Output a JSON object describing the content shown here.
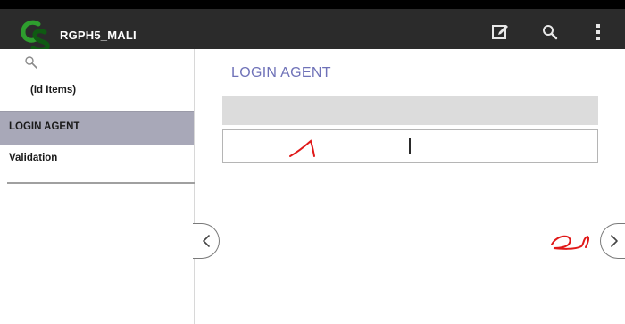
{
  "app": {
    "title": "RGPH5_MALI"
  },
  "toolbar": {
    "icons": [
      "edit-icon",
      "search-icon",
      "overflow-menu-icon"
    ]
  },
  "sidebar": {
    "search_icon": "search-icon",
    "items": [
      {
        "label": "(Id Items)",
        "selected": false
      },
      {
        "label": "LOGIN AGENT",
        "selected": true
      },
      {
        "label": "Validation",
        "selected": false
      }
    ]
  },
  "main": {
    "title": "LOGIN AGENT",
    "input": {
      "value": ""
    },
    "nav": {
      "prev_icon": "chevron-left-icon",
      "next_icon": "chevron-right-icon"
    }
  },
  "colors": {
    "action_bar": "#2b2b2b",
    "title_accent": "#6f72b8",
    "selected_item": "#a8a8b8",
    "logo_green": "#2e9e2e",
    "annotation_red": "#e01919"
  }
}
